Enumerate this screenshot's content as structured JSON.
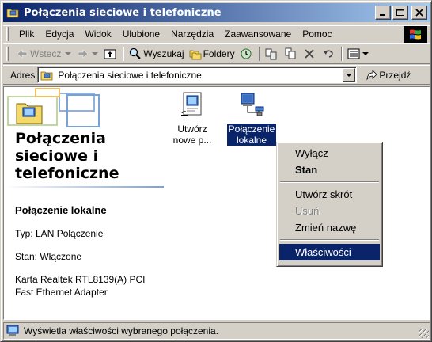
{
  "window": {
    "title": "Połączenia sieciowe i telefoniczne"
  },
  "menu": [
    "Plik",
    "Edycja",
    "Widok",
    "Ulubione",
    "Narzędzia",
    "Zaawansowane",
    "Pomoc"
  ],
  "toolbar": {
    "back_label": "Wstecz",
    "search_label": "Wyszukaj",
    "folders_label": "Foldery"
  },
  "address": {
    "label": "Adres",
    "value": "Połączenia sieciowe i telefoniczne",
    "go_label": "Przejdź"
  },
  "side": {
    "title_line1": "Połączenia",
    "title_line2": "sieciowe i",
    "title_line3": "telefoniczne",
    "heading": "Połączenie lokalne",
    "type": "Typ: LAN Połączenie",
    "status": "Stan: Włączone",
    "adapter_line1": "Karta Realtek RTL8139(A) PCI",
    "adapter_line2": "Fast Ethernet Adapter"
  },
  "icons": {
    "new_line1": "Utwórz",
    "new_line2": "nowe p...",
    "local_line1": "Połączenie",
    "local_line2": "lokalne"
  },
  "context_menu": {
    "disable": "Wyłącz",
    "status": "Stan",
    "shortcut": "Utwórz skrót",
    "delete": "Usuń",
    "rename": "Zmień nazwę",
    "properties": "Właściwości"
  },
  "statusbar": {
    "text": "Wyświetla właściwości wybranego połączenia."
  },
  "colors": {
    "title_start": "#0a246a",
    "title_end": "#a6caf0",
    "selection": "#0a246a",
    "face": "#d4d0c8"
  }
}
